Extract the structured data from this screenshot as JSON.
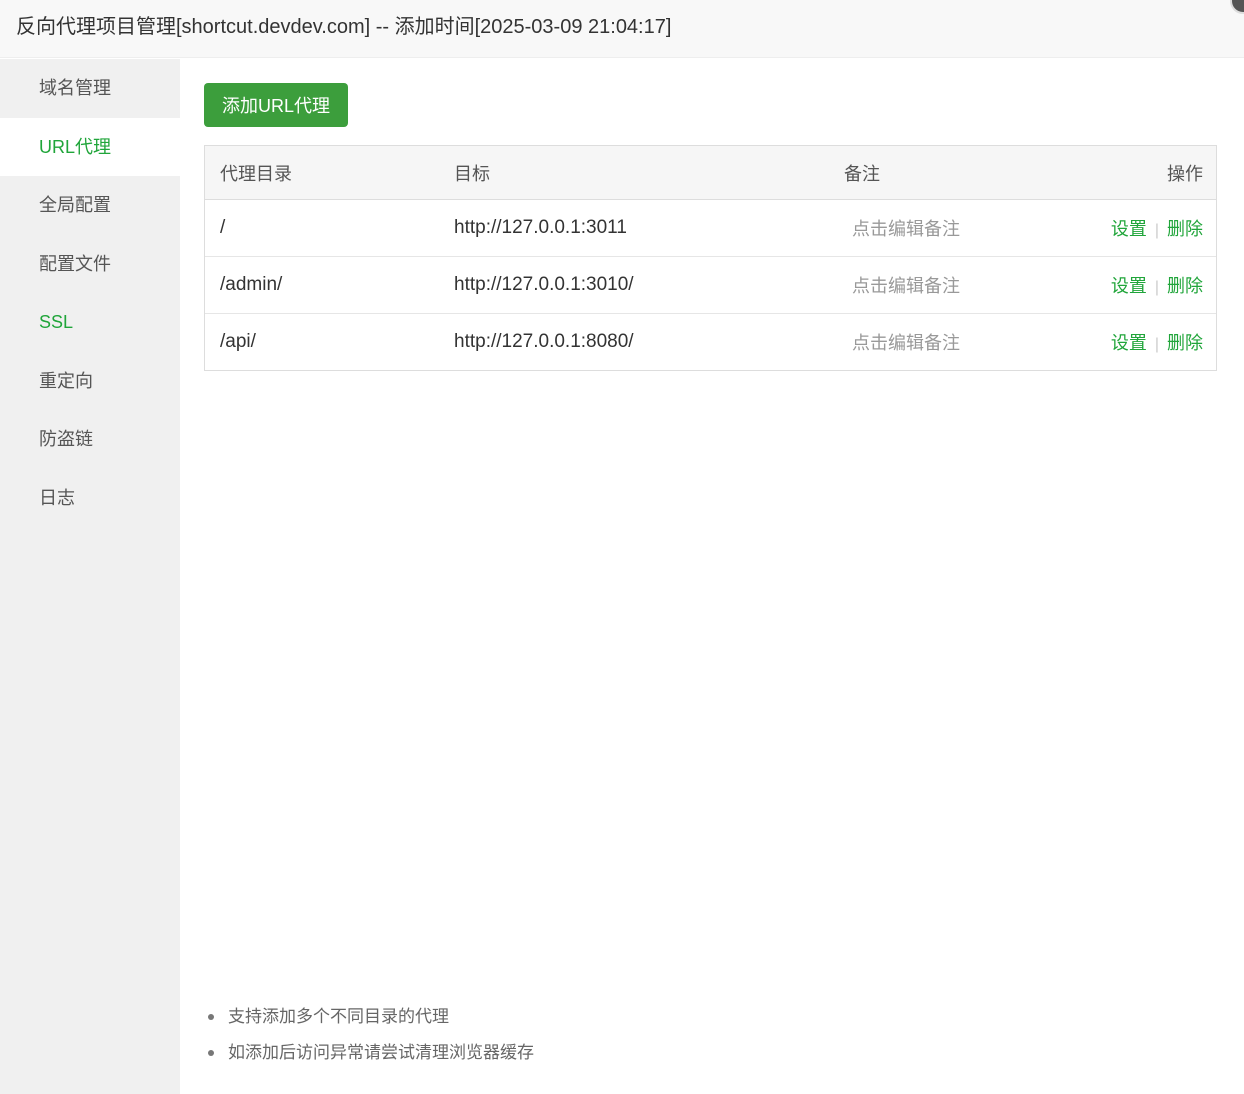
{
  "window": {
    "title": "反向代理项目管理[shortcut.devdev.com] -- 添加时间[2025-03-09 21:04:17]"
  },
  "sidebar": {
    "items": [
      {
        "label": "域名管理"
      },
      {
        "label": "URL代理",
        "active": true
      },
      {
        "label": "全局配置"
      },
      {
        "label": "配置文件"
      },
      {
        "label": "SSL"
      },
      {
        "label": "重定向"
      },
      {
        "label": "防盗链"
      },
      {
        "label": "日志"
      }
    ]
  },
  "main": {
    "add_button": "添加URL代理",
    "table": {
      "headers": [
        "代理目录",
        "目标",
        "备注",
        "操作"
      ],
      "rows": [
        {
          "dir": "/",
          "target": "http://127.0.0.1:3011",
          "remark": "点击编辑备注",
          "action_settings": "设置",
          "action_delete": "删除"
        },
        {
          "dir": "/admin/",
          "target": "http://127.0.0.1:3010/",
          "remark": "点击编辑备注",
          "action_settings": "设置",
          "action_delete": "删除"
        },
        {
          "dir": "/api/",
          "target": "http://127.0.0.1:8080/",
          "remark": "点击编辑备注",
          "action_settings": "设置",
          "action_delete": "删除"
        }
      ],
      "separator": "|"
    },
    "tips": [
      "支持添加多个不同目录的代理",
      "如添加后访问异常请尝试清理浏览器缓存"
    ]
  },
  "colors": {
    "accent": "#20a53a",
    "button": "#3c9e3c",
    "sidebar_bg": "#f0f0f0"
  }
}
